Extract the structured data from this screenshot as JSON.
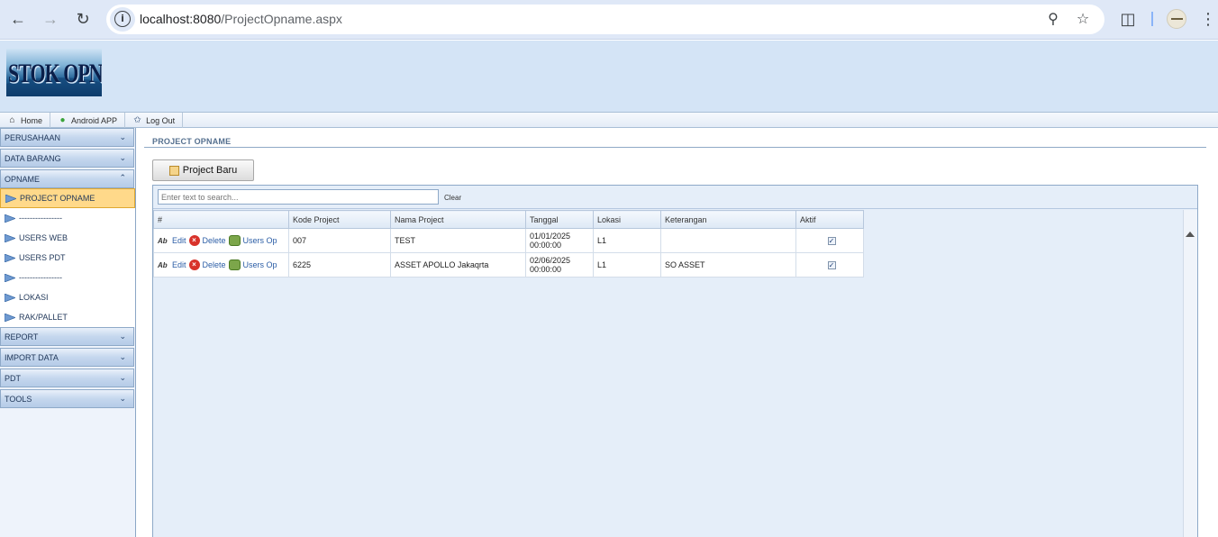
{
  "browser": {
    "url_host": "localhost:8080",
    "url_path": "/ProjectOpname.aspx",
    "icons": [
      "back-icon",
      "forward-icon",
      "reload-icon",
      "info-icon",
      "zoom-icon",
      "star-icon",
      "extensions-icon",
      "menu-icon"
    ]
  },
  "header": {
    "logo_text": "STOK OPNAME"
  },
  "topmenu": {
    "items": [
      {
        "label": "Home",
        "icon": "home-icon"
      },
      {
        "label": "Android APP",
        "icon": "android-icon"
      },
      {
        "label": "Log Out",
        "icon": "walking-person-icon"
      }
    ]
  },
  "sidebar": {
    "sections": [
      {
        "label": "PERUSAHAAN",
        "expanded": false
      },
      {
        "label": "DATA BARANG",
        "expanded": false
      },
      {
        "label": "OPNAME",
        "expanded": true,
        "items": [
          "PROJECT OPNAME",
          "----------------",
          "USERS WEB",
          "USERS PDT",
          "----------------",
          "LOKASI",
          "RAK/PALLET"
        ]
      },
      {
        "label": "REPORT",
        "expanded": false
      },
      {
        "label": "IMPORT DATA",
        "expanded": false
      },
      {
        "label": "PDT",
        "expanded": false
      },
      {
        "label": "TOOLS",
        "expanded": false
      }
    ],
    "active_item": "PROJECT OPNAME"
  },
  "main": {
    "title": "PROJECT OPNAME",
    "new_button": "Project Baru",
    "search": {
      "placeholder": "Enter text to search...",
      "clear_label": "Clear"
    },
    "columns": [
      "#",
      "Kode Project",
      "Nama Project",
      "Tanggal",
      "Lokasi",
      "Keterangan",
      "Aktif"
    ],
    "action_labels": {
      "edit": "Edit",
      "delete": "Delete",
      "users": "Users Op"
    },
    "rows": [
      {
        "kode": "007",
        "nama": "TEST",
        "tanggal_date": "01/01/2025",
        "tanggal_time": "00:00:00",
        "lokasi": "L1",
        "keterangan": "",
        "aktif": true
      },
      {
        "kode": "6225",
        "nama": "ASSET APOLLO Jakaqrta",
        "tanggal_date": "02/06/2025",
        "tanggal_time": "00:00:00",
        "lokasi": "L1",
        "keterangan": "SO ASSET",
        "aktif": true
      }
    ]
  },
  "colors": {
    "header_bg": "#d4e4f6",
    "active_item_bg": "#ffd98a",
    "link": "#2c5ea6"
  }
}
